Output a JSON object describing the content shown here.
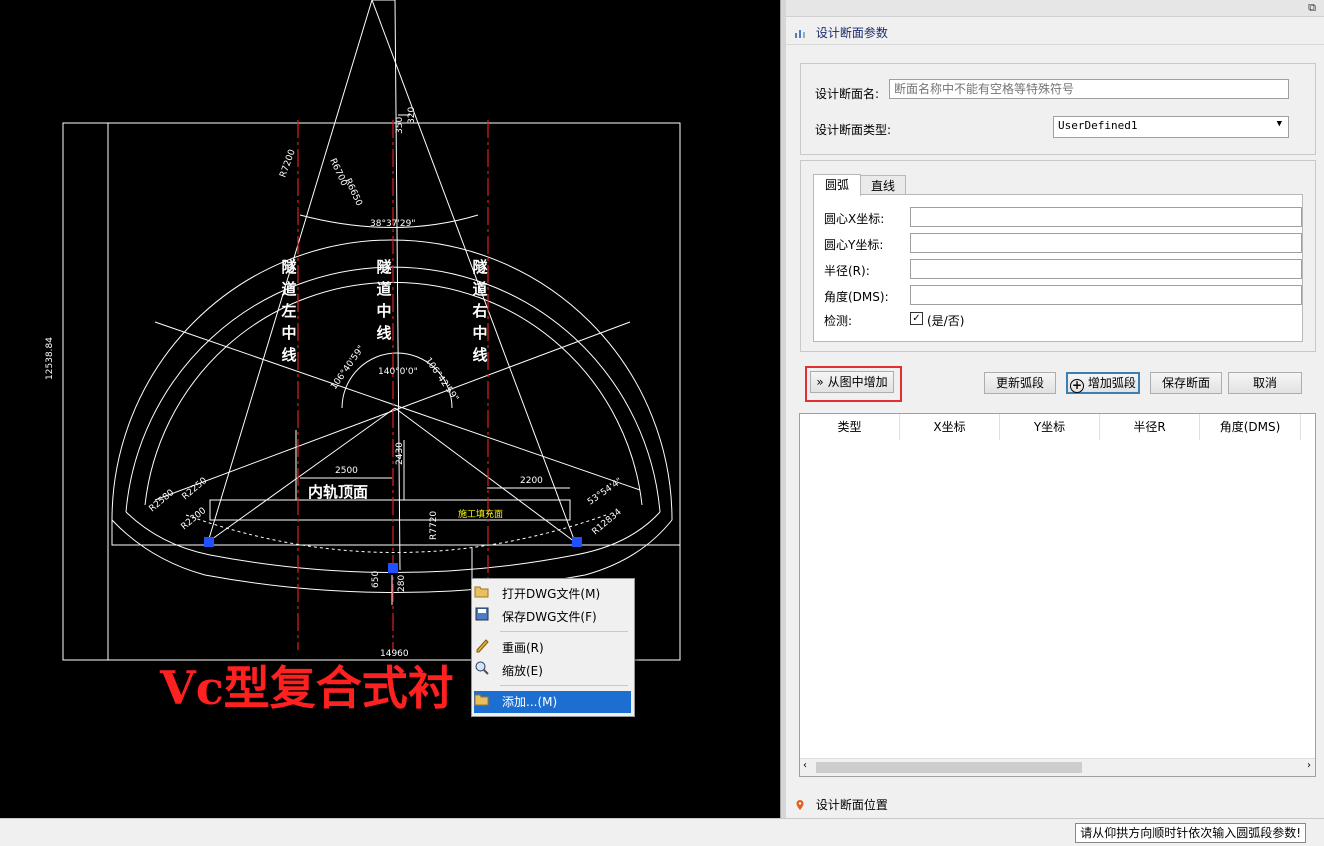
{
  "cad": {
    "labels": {
      "left_centerline": [
        "隧",
        "道",
        "左",
        "中",
        "线"
      ],
      "center_centerline": [
        "隧",
        "道",
        "中",
        "线"
      ],
      "right_centerline": [
        "隧",
        "道",
        "右",
        "中",
        "线"
      ],
      "rail_top": "内轨顶面",
      "construction_surface": "施工填充面",
      "big_title": "Vc型复合式衬",
      "angle_center": "140°0'0\"",
      "angle_top": "38°37'29\"",
      "angle_left": "106°40'59\"",
      "angle_right": "106°42'59\"",
      "angle_bottom_right": "53°54'4\"",
      "dim_width": "14960",
      "dim_height": "12538.84",
      "dim_2500": "2500",
      "dim_2430": "2430",
      "dim_2200": "2200",
      "dim_r7720": "R7720",
      "dim_r6700": "R6700",
      "dim_r6650": "R6650",
      "dim_r7200": "R7200",
      "dim_r2580": "R2580",
      "dim_r2250": "R2250",
      "dim_r2300": "R2300",
      "dim_r12834": "R12834",
      "dim_650": "650",
      "dim_280": "280",
      "dim_350": "350",
      "dim_320": "320"
    },
    "context_menu": {
      "items": [
        {
          "label": "打开DWG文件(M)",
          "icon": "folder-open-icon"
        },
        {
          "label": "保存DWG文件(F)",
          "icon": "save-icon"
        },
        {
          "label": "重画(R)",
          "icon": "pencil-icon"
        },
        {
          "label": "缩放(E)",
          "icon": "zoom-icon"
        },
        {
          "label": "添加...(M)",
          "icon": "add-icon",
          "selected": true
        }
      ]
    }
  },
  "panel": {
    "section_title": "设计断面参数",
    "name_label": "设计断面名:",
    "name_placeholder": "断面名称中不能有空格等特殊符号",
    "type_label": "设计断面类型:",
    "type_value": "UserDefined1",
    "tabs": [
      "圆弧",
      "直线"
    ],
    "fields": [
      {
        "label": "圆心X坐标:",
        "value": ""
      },
      {
        "label": "圆心Y坐标:",
        "value": ""
      },
      {
        "label": "半径(R):",
        "value": ""
      },
      {
        "label": "角度(DMS):",
        "value": ""
      }
    ],
    "check_label": "检测:",
    "check_text": "(是/否)",
    "check_checked": true,
    "buttons": {
      "add_from_drawing": "» 从图中增加",
      "update_arc": "更新弧段",
      "add_arc": "增加弧段",
      "save_section": "保存断面",
      "cancel": "取消"
    },
    "grid_columns": [
      "类型",
      "X坐标",
      "Y坐标",
      "半径R",
      "角度(DMS)"
    ],
    "location_section": "设计断面位置"
  },
  "status": {
    "message": "请从仰拱方向顺时针依次输入圆弧段参数!"
  },
  "colors": {
    "cad_bg": "#000000",
    "cad_line": "#ffffff",
    "centerline": "#e02020",
    "title_red": "#ff2020",
    "highlight": "#e03030",
    "menu_selected": "#1c6fd1",
    "yellow_text": "#ffff00"
  }
}
